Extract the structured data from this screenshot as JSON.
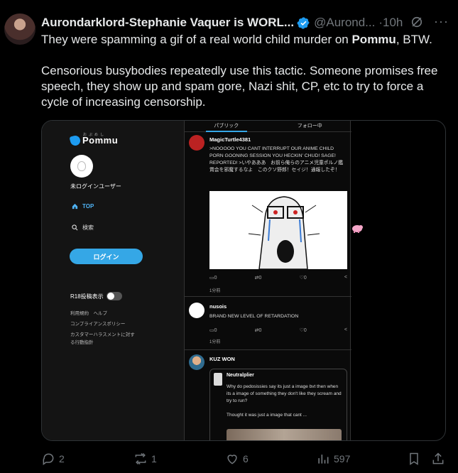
{
  "tweet": {
    "author_name": "Aurondarklord-Stephanie Vaquer is WORL...",
    "handle": "@Aurond...",
    "time": "·10h",
    "text_part1": "They were spamming a gif of a real world child murder on ",
    "text_bold": "Pommu",
    "text_part2": ", BTW.",
    "text_paragraph2": "Censorious busybodies repeatedly use this tactic.  Someone promises free speech, they show up and spam gore, Nazi shit, CP, etc to try to force a cycle of increasing censorship."
  },
  "embedded_screenshot": {
    "logo": "Pommu",
    "logo_sub": "おぷめし",
    "user_label": "未ログインユーザー",
    "nav_top": "TOP",
    "nav_search": "検索",
    "login_button": "ログイン",
    "r18_label": "R18投稿表示",
    "footer_links": [
      "利用規約　ヘルプ",
      "コンプライアンスポリシー",
      "カスタマーハラスメントに対す",
      "る行動指針"
    ],
    "tabs": [
      "パブリック",
      "フォロー中"
    ],
    "posts": [
      {
        "name": "MagicTurtle4381",
        "text": ">NOOOOO YOU CANT INTERRUPT OUR ANIME CHILD PORN GOONING SESSION YOU HECKIN' CHUD! SAGE! REPORTED! >いやあああ　お前ら俺らのアニメ児童ポルノ鑑賞会を邪魔するなよ　このクソ野郎！セイジ！通報したぞ！",
        "reply": "0",
        "repost": "0",
        "like": "0",
        "time": "1分前"
      },
      {
        "name": "nusois",
        "text": "BRAND NEW LEVEL OF RETARDATION",
        "reply": "0",
        "repost": "0",
        "like": "0",
        "time": "1分前"
      },
      {
        "name": "KUZ WON",
        "quote_name": "Neutralplier",
        "quote_text1": "Why do pedosissies say its just a image bvt then when its a image of something they don't like they scream and try to run?",
        "quote_text2": "Thought it was just a image that cant ..."
      }
    ]
  },
  "actions": {
    "replies": "2",
    "reposts": "1",
    "likes": "6",
    "views": "597"
  },
  "colors": {
    "background": "#000000",
    "text": "#e7e9ea",
    "muted": "#71767b",
    "verified": "#1d9bf0",
    "pommu_accent": "#35a7e6"
  }
}
